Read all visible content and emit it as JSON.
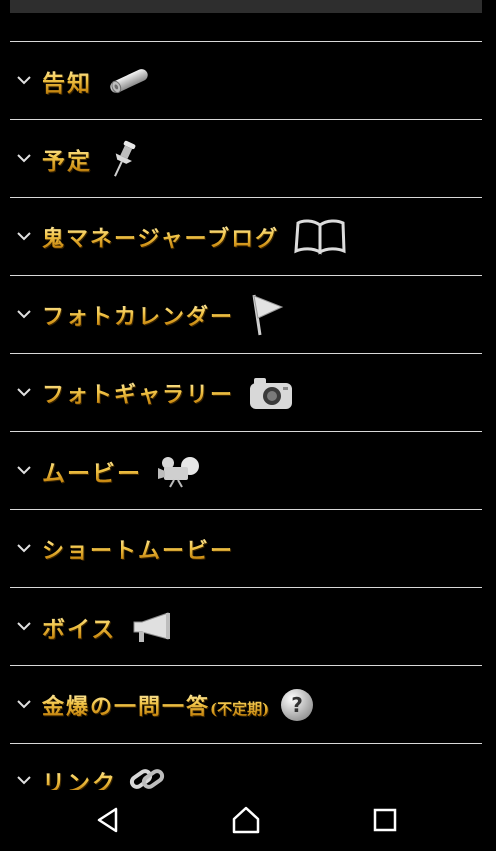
{
  "menu": {
    "items": [
      {
        "label": "告知",
        "icon": "rolled-paper-icon"
      },
      {
        "label": "予定",
        "icon": "pushpin-icon"
      },
      {
        "label": "鬼マネージャーブログ",
        "icon": "open-book-icon"
      },
      {
        "label": "フォトカレンダー",
        "icon": "flag-icon"
      },
      {
        "label": "フォトギャラリー",
        "icon": "camera-icon"
      },
      {
        "label": "ムービー",
        "icon": "video-camera-icon"
      },
      {
        "label": "ショートムービー",
        "icon": ""
      },
      {
        "label": "ボイス",
        "icon": "megaphone-icon"
      },
      {
        "label": "金爆の一問一答",
        "sub": "(不定期)",
        "icon": "question-icon"
      },
      {
        "label": "リンク",
        "icon": "link-icon"
      }
    ]
  },
  "nav": {
    "back": "back-icon",
    "home": "home-icon",
    "recents": "recents-icon"
  },
  "colors": {
    "background": "#000000",
    "divider": "#d8d8d8",
    "label_gold": "#f2c64a",
    "icon_silver": "#d0d0d0"
  }
}
